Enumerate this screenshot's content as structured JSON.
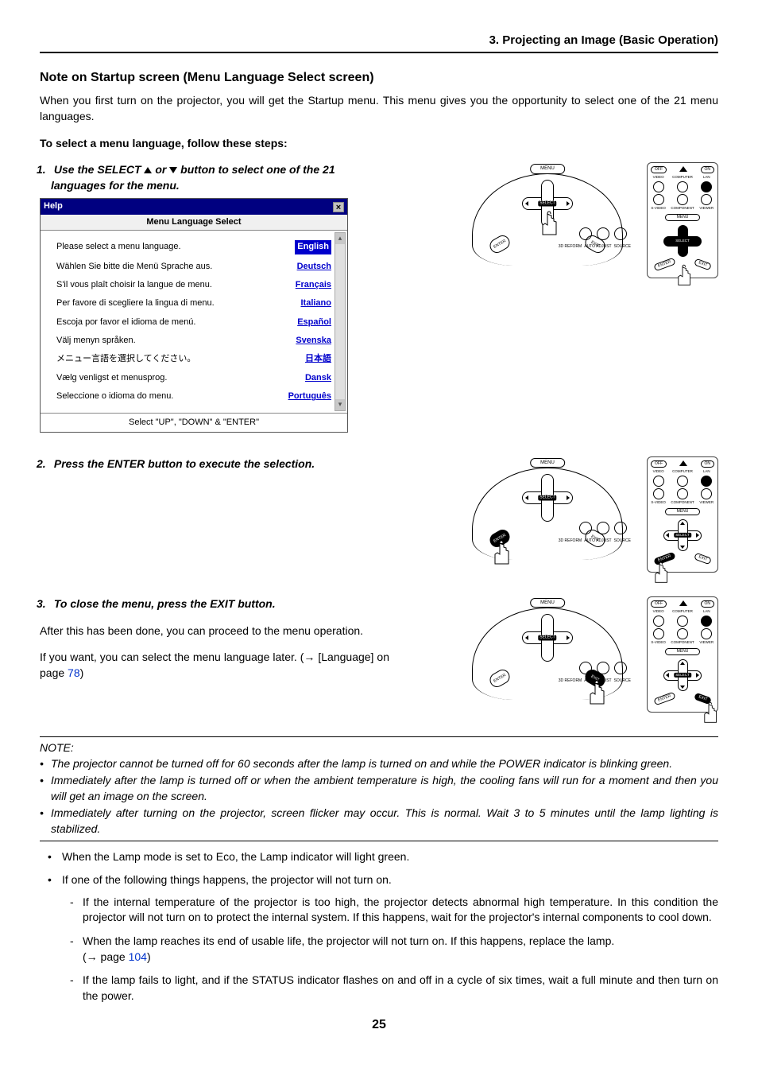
{
  "header": "3. Projecting an Image (Basic Operation)",
  "subheading": "Note on Startup screen (Menu Language Select screen)",
  "intro": "When you first turn on the projector, you will get the Startup menu. This menu gives you the opportunity to select one of the 21 menu languages.",
  "steps_intro": "To select a menu language, follow these steps:",
  "step1_prefix": "1.",
  "step1_a": "Use the SELECT ",
  "step1_b": " or ",
  "step1_c": " button to select one of the 21 languages for the menu.",
  "menu_box": {
    "titlebar": "Help",
    "subtitle": "Menu Language Select",
    "rows": [
      {
        "prompt": "Please select a menu language.",
        "lang": "English",
        "selected": true
      },
      {
        "prompt": "Wählen Sie bitte die Menü Sprache aus.",
        "lang": "Deutsch"
      },
      {
        "prompt": "S'il vous plaît choisir la langue de menu.",
        "lang": "Français"
      },
      {
        "prompt": "Per favore di scegliere la lingua di menu.",
        "lang": "Italiano"
      },
      {
        "prompt": "Escoja por favor el idioma de menú.",
        "lang": "Español"
      },
      {
        "prompt": "Välj menyn språken.",
        "lang": "Svenska"
      },
      {
        "prompt": "メニュー言語を選択してください。",
        "lang": "日本語"
      },
      {
        "prompt": "Vælg venligst et menusprog.",
        "lang": "Dansk"
      },
      {
        "prompt": "Seleccione o idioma do menu.",
        "lang": "Português"
      }
    ],
    "footer": "Select   \"UP\", \"DOWN\"   &   \"ENTER\""
  },
  "panel": {
    "menu": "MENU",
    "select": "SELECT",
    "enter": "ENTER",
    "exit": "EXIT",
    "b1": "3D REFORM",
    "b2": "AUTO ADJUST",
    "b3": "SOURCE"
  },
  "remote": {
    "off": "OFF",
    "on": "ON",
    "computer": "COMPUTER",
    "video": "VIDEO",
    "viewer": "VIEWER",
    "component": "COMPONENT",
    "lan": "LAN",
    "svideo": "S-VIDEO",
    "menu": "MENU",
    "select": "SELECT",
    "enter": "ENTER",
    "exit": "EXIT"
  },
  "step2_prefix": "2.",
  "step2": "Press the ENTER button to execute the selection.",
  "step3_prefix": "3.",
  "step3": "To close the menu, press the EXIT button.",
  "after1": "After this has been done, you can proceed to the menu operation.",
  "after2_a": "If you want, you can select the menu language later. (",
  "after2_b": " [Language] on page ",
  "after2_link": "78",
  "after2_c": ")",
  "note_title": "NOTE:",
  "note_items": [
    "The projector cannot be turned off for 60 seconds after the lamp is turned on and while the POWER indicator is blinking green.",
    "Immediately after the lamp is turned off or when the ambient temperature is high, the cooling fans will run for a moment and then you will get an image on the screen.",
    "Immediately after turning on the projector, screen flicker may occur. This is normal. Wait 3 to 5 minutes until the lamp lighting is stabilized."
  ],
  "bullets": {
    "b1": "When the Lamp mode is set to Eco, the Lamp indicator will light green.",
    "b2": "If one of the following things happens, the projector will not turn on.",
    "d1": "If the internal temperature of the projector is too high, the projector detects abnormal high temperature. In this condition the projector will not turn on to protect the internal system. If this happens, wait for the projector's internal components to cool down.",
    "d2_a": "When the lamp reaches its end of usable life, the projector will not turn on. If this happens, replace the lamp.",
    "d2_b": "(",
    "d2_c": " page ",
    "d2_link": "104",
    "d2_d": ")",
    "d3": "If the lamp fails to light, and if the STATUS indicator flashes on and off in a cycle of six times, wait a full minute and then turn on the power."
  },
  "page_number": "25",
  "arrow_right": "→"
}
